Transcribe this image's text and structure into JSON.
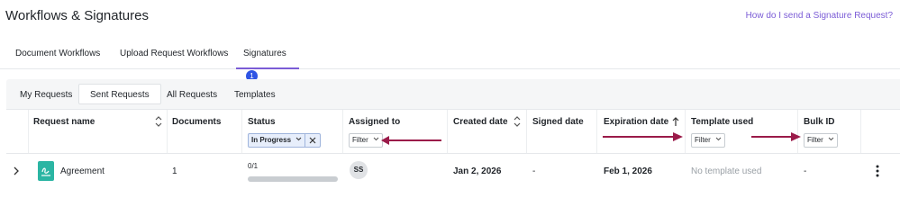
{
  "page": {
    "title": "Workflows & Signatures",
    "help_link": "How do I send a Signature Request?"
  },
  "main_tabs": [
    {
      "label": "Document Workflows",
      "active": false
    },
    {
      "label": "Upload Request Workflows",
      "active": false
    },
    {
      "label": "Signatures",
      "active": true,
      "badge": "1"
    }
  ],
  "sub_tabs": [
    {
      "label": "My Requests",
      "active": false
    },
    {
      "label": "Sent Requests",
      "active": true
    },
    {
      "label": "All Requests",
      "active": false
    },
    {
      "label": "Templates",
      "active": false
    }
  ],
  "columns": {
    "request_name": "Request name",
    "documents": "Documents",
    "status": "Status",
    "assigned_to": "Assigned to",
    "created_date": "Created date",
    "signed_date": "Signed date",
    "expiration_date": "Expiration date",
    "template_used": "Template used",
    "bulk_id": "Bulk ID"
  },
  "filters": {
    "status_chip": "In Progress",
    "assigned_to": "Filter",
    "template_used": "Filter",
    "bulk_id": "Filter"
  },
  "rows": [
    {
      "request_name": "Agreement",
      "documents": "1",
      "progress_label": "0/1",
      "progress_fraction": 0,
      "assignee_initials": "SS",
      "created_date": "Jan 2, 2026",
      "signed_date": "-",
      "expiration_date": "Feb 1, 2026",
      "template_used": "No template used",
      "bulk_id": "-"
    }
  ],
  "colors": {
    "accent_purple": "#7b5cd6",
    "badge_blue": "#2f55e4",
    "annotation_arrow": "#9b1b4a",
    "doc_icon_teal": "#2bb5a3"
  },
  "icons": [
    "sort-icon",
    "sort-up-icon",
    "chevron-down-icon",
    "close-icon",
    "chevron-right-icon",
    "signature-document-icon",
    "more-vertical-icon"
  ]
}
